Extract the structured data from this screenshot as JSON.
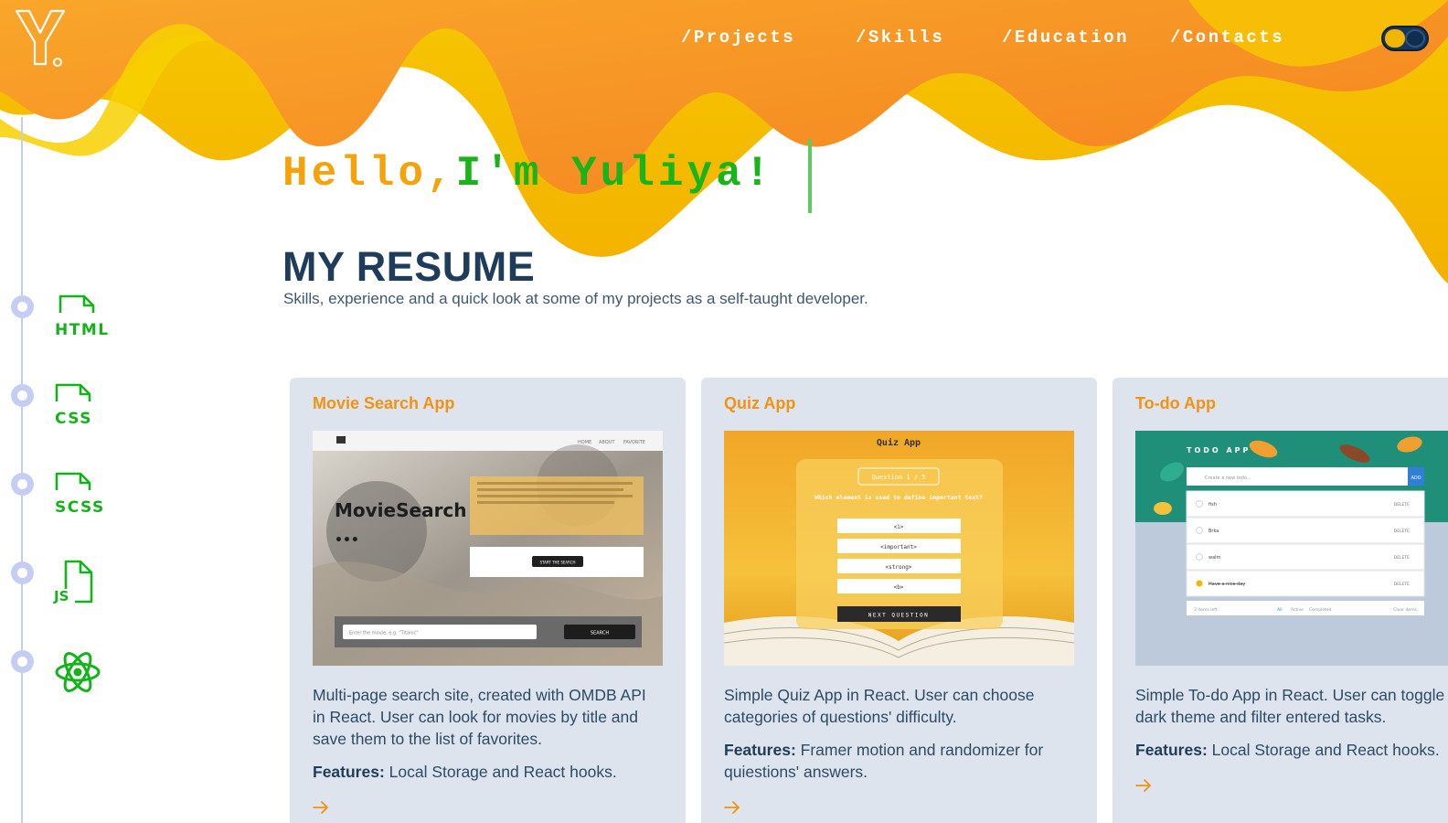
{
  "brand": {
    "logo_letter": "Y"
  },
  "nav": {
    "items": [
      {
        "label": "/Projects"
      },
      {
        "label": "/Skills"
      },
      {
        "label": "/Education"
      },
      {
        "label": "/Contacts"
      }
    ],
    "theme_toggle": {
      "state": "dark"
    }
  },
  "hero": {
    "greeting_part1": "Hello,",
    "greeting_part2": "I'm Yuliya!",
    "title": "MY RESUME",
    "subtitle": "Skills, experience and a quick look at some of my projects as a self-taught developer."
  },
  "skills": [
    {
      "label": "HTML",
      "icon": "file-icon"
    },
    {
      "label": "CSS",
      "icon": "file-icon"
    },
    {
      "label": "SCSS",
      "icon": "file-icon"
    },
    {
      "label": "JS",
      "icon": "js-file-icon"
    },
    {
      "label": "React",
      "icon": "react-atom-icon"
    }
  ],
  "projects": [
    {
      "title": "Movie Search App",
      "description": "Multi-page search site, created with OMDB API in React. User can look for movies by title and save them to the list of favorites.",
      "features_label": "Features:",
      "features": "Local Storage and React hooks.",
      "screenshot": {
        "nav": [
          "HOME",
          "ABOUT",
          "FAVORITE"
        ],
        "heading": "MovieSearch",
        "cta": "START THE SEARCH",
        "search_placeholder": "Enter the movie, e.g. \"Titanic\"",
        "search_button": "SEARCH"
      }
    },
    {
      "title": "Quiz App",
      "description": "Simple Quiz App in React. User can choose categories of questions' difficulty.",
      "features_label": "Features:",
      "features": "Framer motion and randomizer for quiestions' answers.",
      "screenshot": {
        "heading": "Quiz App",
        "progress": "Question 1 / 5",
        "question": "Which element is used to define important text?",
        "answers": [
          "<i>",
          "<important>",
          "<strong>",
          "<b>"
        ],
        "next": "NEXT QUESTION"
      }
    },
    {
      "title": "To-do App",
      "description": "Simple To-do App in React. User can toggle light and dark theme and filter entered tasks.",
      "features_label": "Features:",
      "features": "Local Storage and React hooks.",
      "screenshot": {
        "heading": "TODO APP",
        "placeholder": "Create a new todo...",
        "add": "ADD",
        "items": [
          "fish",
          "Brka",
          "walm",
          "Have a nice day"
        ],
        "delete_label": "DELETE",
        "footer_left": "3 items left",
        "filters": [
          "All",
          "Active",
          "Completed"
        ],
        "clear": "Clear items"
      }
    }
  ],
  "colors": {
    "accent_orange": "#f39212",
    "wave_yellow": "#f2c100",
    "heading_navy": "#1f3c5a",
    "hello_green": "#19b419",
    "card_bg": "#dde4ed",
    "timeline": "#c6cdf3"
  }
}
